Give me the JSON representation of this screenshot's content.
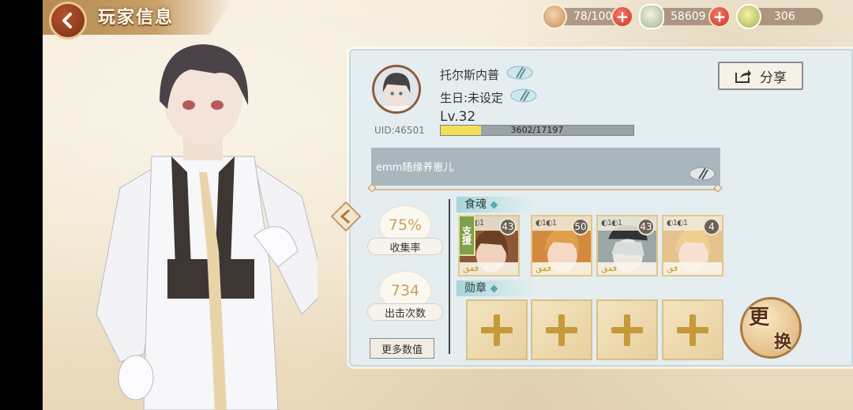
{
  "header": {
    "title": "玩家信息"
  },
  "resources": [
    {
      "icon": "bowl-icon",
      "value": "78/100",
      "has_plus": true
    },
    {
      "icon": "jade-icon",
      "value": "58609",
      "has_plus": true
    },
    {
      "icon": "coin-icon",
      "value": "306",
      "has_plus": false
    }
  ],
  "profile": {
    "name": "托尔斯内普",
    "birthday": "生日:未设定",
    "level": "Lv.32",
    "uid": "UID:46501",
    "exp_text": "3602/17197",
    "exp_fraction": 0.2094,
    "signature": "emm随缘养崽儿"
  },
  "share": {
    "label": "分享"
  },
  "stats": {
    "collection_value": "75%",
    "collection_label": "收集率",
    "sorties_value": "734",
    "sorties_label": "出击次数",
    "more_label": "更多数值"
  },
  "souls": {
    "section_label": "食魂",
    "support_label": "支援",
    "cards": [
      {
        "level": "43",
        "stars": "ddd",
        "bg": "#7a4a2a"
      },
      {
        "level": "50",
        "stars": "ddd",
        "bg": "#c97d36"
      },
      {
        "level": "43",
        "stars": "ddd",
        "bg": "#8c9a9c"
      },
      {
        "level": "4",
        "stars": "dd",
        "bg": "#d7b37a"
      }
    ]
  },
  "medals": {
    "section_label": "勋章"
  },
  "change": {
    "line1": "更",
    "line2": "换"
  },
  "colors": {
    "accent": "#c9a16a",
    "panel": "#e4edf0",
    "exp_fill": "#f2e05a"
  }
}
